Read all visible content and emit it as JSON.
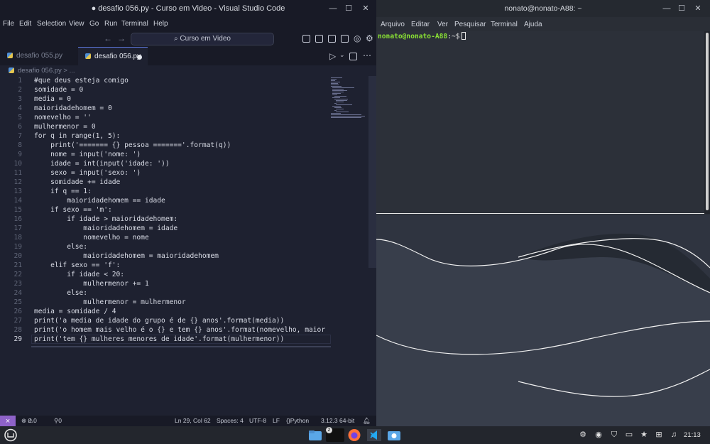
{
  "vscode": {
    "title": "● desafio 056.py - Curso em Video - Visual Studio Code",
    "menu": [
      "File",
      "Edit",
      "Selection",
      "View",
      "Go",
      "Run",
      "Terminal",
      "Help"
    ],
    "command_center": "Curso em Video",
    "tabs": [
      {
        "label": "desafio 055.py",
        "active": false
      },
      {
        "label": "desafio 056.py",
        "active": true,
        "dirty": true
      }
    ],
    "breadcrumb": "desafio 056.py > ...",
    "code_lines": [
      "#que deus esteja comigo",
      "somidade = 0",
      "media = 0",
      "maioridadehomem = 0",
      "nomevelho = ''",
      "mulhermenor = 0",
      "for q in range(1, 5):",
      "    print('======= {} pessoa ======='.format(q))",
      "    nome = input('nome: ')",
      "    idade = int(input('idade: '))",
      "    sexo = input('sexo: ')",
      "    somidade += idade",
      "    if q == 1:",
      "        maioridadehomem == idade",
      "    if sexo == 'm':",
      "        if idade > maioridadehomem:",
      "            maioridadehomem = idade",
      "            nomevelho = nome",
      "        else:",
      "            maioridadehomem = maioridadehomem",
      "    elif sexo == 'f':",
      "        if idade < 20:",
      "            mulhermenor += 1",
      "        else:",
      "            mulhermenor = mulhermenor",
      "media = somidade / 4",
      "print('a media de idade do grupo é de {} anos'.format(media))",
      "print('o homem mais velho é o {} e tem {} anos'.format(nomevelho, maior",
      "print('tem {} mulheres menores de idade'.format(mulhermenor))"
    ],
    "status": {
      "errors": "0",
      "warnings": "0",
      "ports": "0",
      "position": "Ln 29, Col 62",
      "spaces": "Spaces: 4",
      "encoding": "UTF-8",
      "eol": "LF",
      "language": "Python",
      "interpreter": "3.12.3 64-bit"
    }
  },
  "terminal": {
    "title": "nonato@nonato-A88: ~",
    "menu": [
      "Arquivo",
      "Editar",
      "Ver",
      "Pesquisar",
      "Terminal",
      "Ajuda"
    ],
    "prompt_user": "nonato@nonato-A88",
    "prompt_rest": ":~$"
  },
  "taskbar": {
    "time": "21:13",
    "terminal_badge": "2"
  },
  "colors": {
    "python_purple": "#8e62c8",
    "prompt_green": "#8ae234",
    "editor_bg": "#1e2130"
  }
}
